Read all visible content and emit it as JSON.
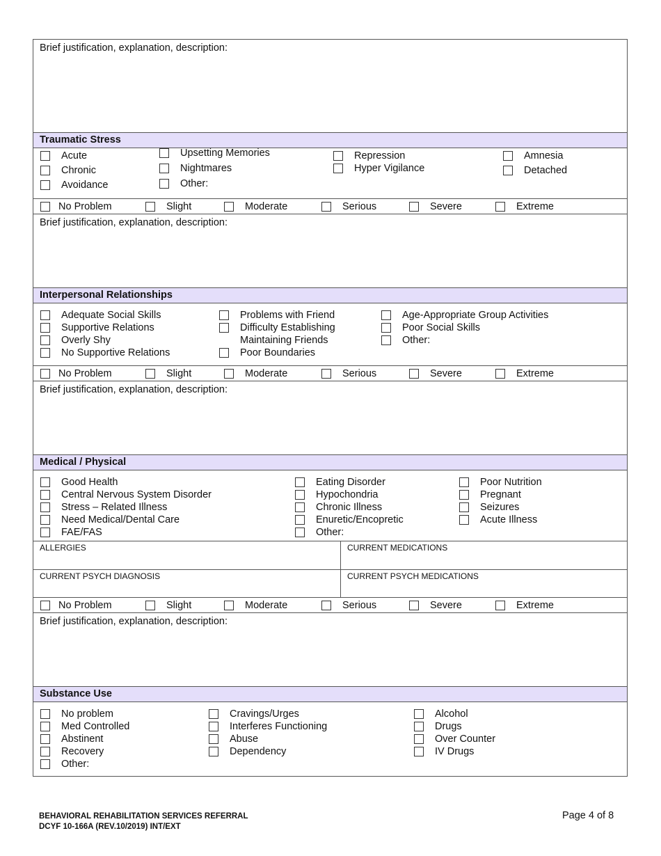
{
  "justification_label": "Brief justification, explanation, description:",
  "severity_scale": [
    "No Problem",
    "Slight",
    "Moderate",
    "Serious",
    "Severe",
    "Extreme"
  ],
  "sections": {
    "traumatic_stress": {
      "title": "Traumatic Stress",
      "col1": [
        "Acute",
        "Chronic",
        "Avoidance"
      ],
      "col2": [
        "Upsetting Memories",
        "Nightmares",
        "Other:"
      ],
      "col3": [
        "Repression",
        "Hyper Vigilance"
      ],
      "col4": [
        "Amnesia",
        "Detached"
      ]
    },
    "interpersonal": {
      "title": "Interpersonal Relationships",
      "col1": [
        "Adequate Social Skills",
        "Supportive Relations",
        "Overly Shy",
        "No Supportive Relations"
      ],
      "col2": [
        "Problems with Friend",
        "Difficulty Establishing",
        "Maintaining Friends",
        "Poor Boundaries"
      ],
      "col3": [
        "Age-Appropriate Group Activities",
        "Poor Social Skills",
        "Other:"
      ]
    },
    "medical": {
      "title": "Medical / Physical",
      "col1": [
        "Good Health",
        "Central Nervous System Disorder",
        "Stress – Related Illness",
        "Need Medical/Dental Care",
        "FAE/FAS"
      ],
      "col2": [
        "Eating Disorder",
        "Hypochondria",
        "Chronic Illness",
        "Enuretic/Encopretic",
        "Other:"
      ],
      "col3": [
        "Poor Nutrition",
        "Pregnant",
        "Seizures",
        "Acute Illness"
      ],
      "fields": {
        "allergies": "ALLERGIES",
        "current_medications": "CURRENT MEDICATIONS",
        "current_psych_diagnosis": "CURRENT PSYCH DIAGNOSIS",
        "current_psych_medications": "CURRENT PSYCH MEDICATIONS"
      }
    },
    "substance": {
      "title": "Substance Use",
      "col1": [
        "No problem",
        "Med Controlled",
        "Abstinent",
        "Recovery",
        "Other:"
      ],
      "col2": [
        "Cravings/Urges",
        "Interferes Functioning",
        "Abuse",
        "Dependency"
      ],
      "col3": [
        "Alcohol",
        "Drugs",
        "Over Counter",
        "IV Drugs"
      ]
    }
  },
  "footer": {
    "form_title": "BEHAVIORAL REHABILITATION SERVICES REFERRAL",
    "form_number": "DCYF 10-166A (REV.10/2019) INT/EXT",
    "page": "Page 4 of 8"
  }
}
